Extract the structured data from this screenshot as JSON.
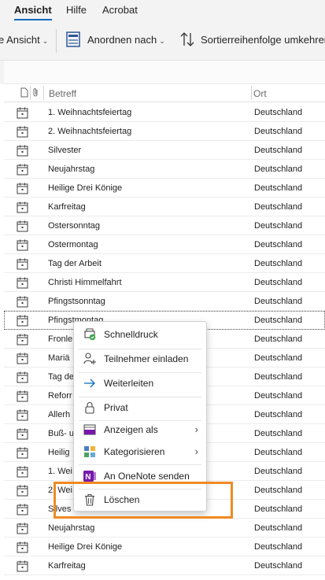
{
  "ribbon": {
    "tabs": [
      "Ansicht",
      "Hilfe",
      "Acrobat"
    ],
    "active_tab": "Ansicht",
    "toolbar": {
      "view_label": "e Ansicht",
      "arrange_label": "Anordnen nach",
      "sort_label": "Sortierreihenfolge umkehren"
    }
  },
  "columns": {
    "subject": "Betreff",
    "location": "Ort"
  },
  "rows": [
    {
      "subject": "1. Weihnachtsfeiertag",
      "location": "Deutschland"
    },
    {
      "subject": "2. Weihnachtsfeiertag",
      "location": "Deutschland"
    },
    {
      "subject": "Silvester",
      "location": "Deutschland"
    },
    {
      "subject": "Neujahrstag",
      "location": "Deutschland"
    },
    {
      "subject": "Heilige Drei Könige",
      "location": "Deutschland"
    },
    {
      "subject": "Karfreitag",
      "location": "Deutschland"
    },
    {
      "subject": "Ostersonntag",
      "location": "Deutschland"
    },
    {
      "subject": "Ostermontag",
      "location": "Deutschland"
    },
    {
      "subject": "Tag der Arbeit",
      "location": "Deutschland"
    },
    {
      "subject": "Christi Himmelfahrt",
      "location": "Deutschland"
    },
    {
      "subject": "Pfingstsonntag",
      "location": "Deutschland"
    },
    {
      "subject": "Pfingstmontag",
      "location": "Deutschland"
    },
    {
      "subject": "Fronle",
      "location": "Deutschland"
    },
    {
      "subject": "Mariä",
      "location": "Deutschland"
    },
    {
      "subject": "Tag de",
      "location": "Deutschland"
    },
    {
      "subject": "Reforr",
      "location": "Deutschland"
    },
    {
      "subject": "Allerh",
      "location": "Deutschland"
    },
    {
      "subject": "Buß- u",
      "location": "Deutschland"
    },
    {
      "subject": "Heilig",
      "location": "Deutschland"
    },
    {
      "subject": "1. Wei",
      "location": "Deutschland"
    },
    {
      "subject": "2. Wei",
      "location": "Deutschland"
    },
    {
      "subject": "Silves",
      "location": "Deutschland"
    },
    {
      "subject": "Neujahrstag",
      "location": "Deutschland"
    },
    {
      "subject": "Heilige Drei Könige",
      "location": "Deutschland"
    },
    {
      "subject": "Karfreitag",
      "location": "Deutschland"
    }
  ],
  "context_menu": {
    "items": [
      {
        "label": "Schnelldruck",
        "icon": "quick-print-icon"
      },
      {
        "label": "Teilnehmer einladen",
        "icon": "invite-attendees-icon"
      },
      {
        "label": "Weiterleiten",
        "icon": "forward-arrow-icon"
      },
      {
        "label": "Privat",
        "icon": "lock-icon"
      },
      {
        "label": "Anzeigen als",
        "icon": "show-as-icon",
        "submenu": true
      },
      {
        "label": "Kategorisieren",
        "icon": "categorize-icon",
        "submenu": true
      },
      {
        "label": "An OneNote senden",
        "icon": "onenote-icon"
      },
      {
        "label": "Löschen",
        "icon": "trash-icon"
      }
    ]
  },
  "colors": {
    "accent": "#0f6cbd",
    "highlight": "#f08a24",
    "onenote": "#7719aa"
  }
}
